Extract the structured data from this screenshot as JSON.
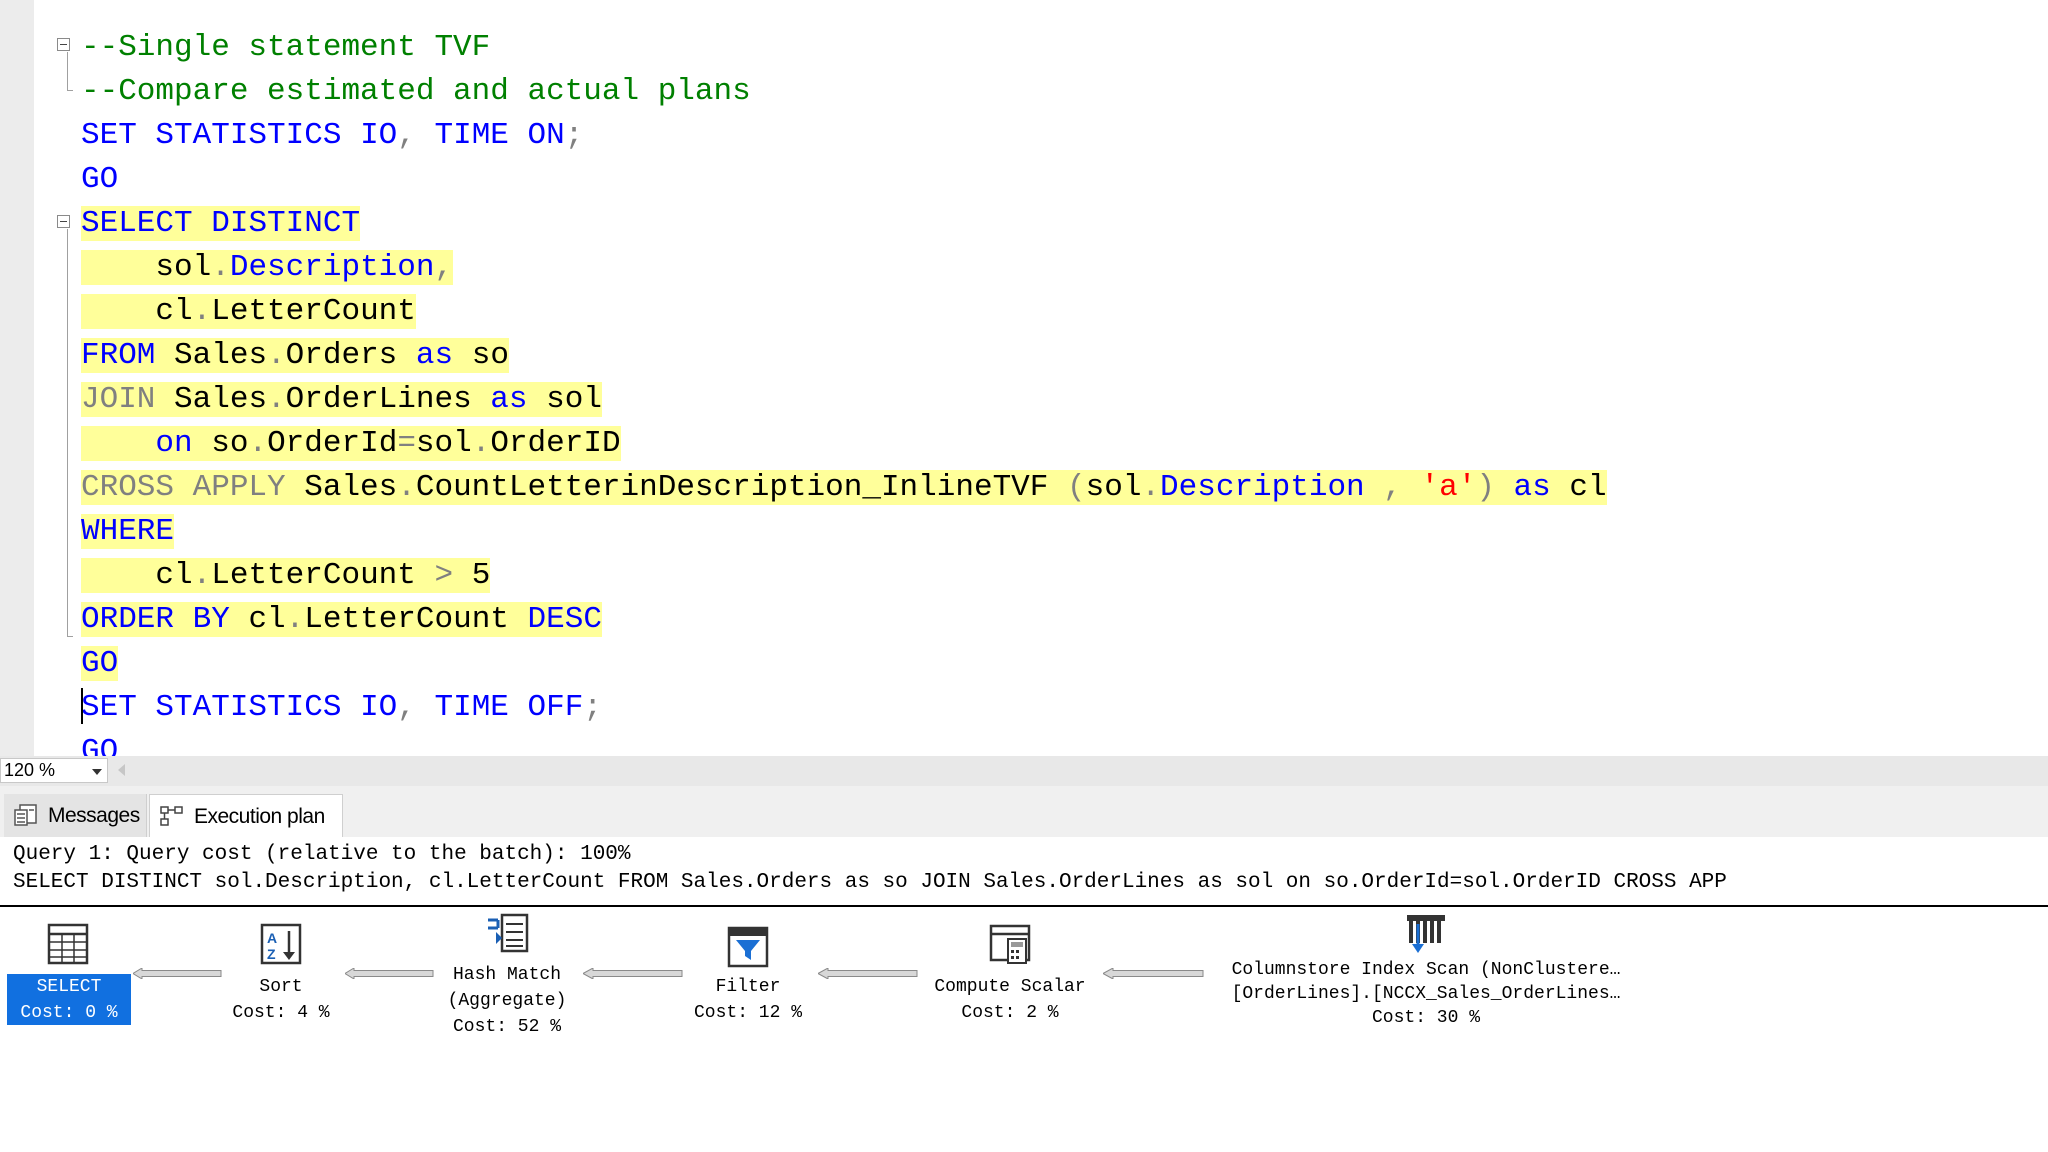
{
  "editor": {
    "lines": [
      "--Single statement TVF",
      "--Compare estimated and actual plans",
      "SET STATISTICS IO, TIME ON;",
      "GO",
      "SELECT DISTINCT",
      "    sol.Description,",
      "    cl.LetterCount",
      "FROM Sales.Orders as so",
      "JOIN Sales.OrderLines as sol",
      "    on so.OrderId=sol.OrderID",
      "CROSS APPLY Sales.CountLetterinDescription_InlineTVF (sol.Description , 'a') as cl",
      "WHERE",
      "    cl.LetterCount > 5",
      "ORDER BY cl.LetterCount DESC",
      "GO",
      "SET STATISTICS IO, TIME OFF;",
      "GO"
    ]
  },
  "zoom": {
    "value": "120 %"
  },
  "results_tabs": [
    {
      "label": "Messages",
      "icon": "messages-icon"
    },
    {
      "label": "Execution plan",
      "icon": "execution-plan-icon",
      "active": true
    }
  ],
  "plan": {
    "query_header": "Query 1: Query cost (relative to the batch): 100%",
    "query_text": "SELECT DISTINCT sol.Description, cl.LetterCount FROM Sales.Orders as so JOIN Sales.OrderLines as sol on so.OrderId=sol.OrderID CROSS APP",
    "operators": [
      {
        "name": "SELECT",
        "cost": "Cost: 0 %",
        "icon": "select-icon",
        "selected": true
      },
      {
        "name": "Sort",
        "cost": "Cost: 4 %",
        "icon": "sort-icon"
      },
      {
        "name": "Hash Match",
        "detail": "(Aggregate)",
        "cost": "Cost: 52 %",
        "icon": "hash-match-icon"
      },
      {
        "name": "Filter",
        "cost": "Cost: 12 %",
        "icon": "filter-icon"
      },
      {
        "name": "Compute Scalar",
        "cost": "Cost: 2 %",
        "icon": "compute-scalar-icon"
      },
      {
        "name": "Columnstore Index Scan (NonClustere…",
        "detail": "[OrderLines].[NCCX_Sales_OrderLines…",
        "cost": "Cost: 30 %",
        "icon": "columnstore-index-scan-icon"
      }
    ]
  },
  "colors": {
    "keyword": "#0000ff",
    "comment": "#008000",
    "operator": "#808080",
    "string": "#ff0000",
    "highlight": "#ffff9a",
    "selected_operator": "#1170e0"
  }
}
